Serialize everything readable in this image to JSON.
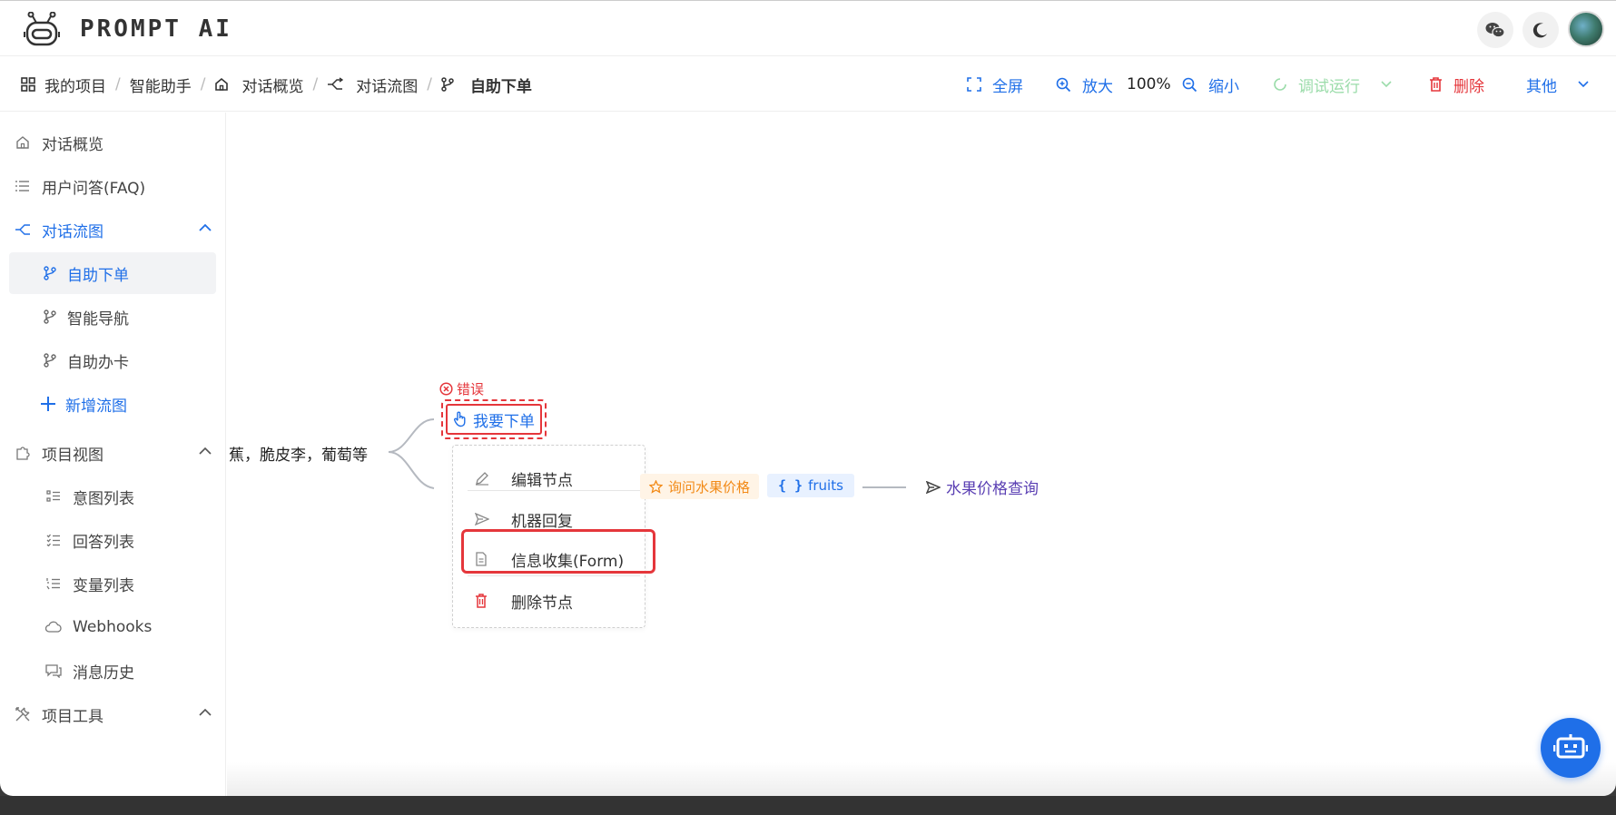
{
  "app": {
    "brand": "PROMPT  AI"
  },
  "breadcrumb": {
    "items": [
      "我的项目",
      "智能助手",
      "对话概览",
      "对话流图",
      "自助下单"
    ],
    "separator": "/"
  },
  "toolbar": {
    "fullscreen_label": "全屏",
    "zoom_in_label": "放大",
    "zoom_level": "100%",
    "zoom_out_label": "缩小",
    "debug_run_label": "调试运行",
    "delete_label": "删除",
    "more_label": "其他"
  },
  "sidebar": {
    "items": [
      {
        "label": "对话概览",
        "icon": "home-icon"
      },
      {
        "label": "用户问答(FAQ)",
        "icon": "list-icon"
      },
      {
        "label": "对话流图",
        "icon": "flow-icon",
        "expanded": true
      },
      {
        "label": "自助下单",
        "icon": "branch-icon",
        "active": true
      },
      {
        "label": "智能导航",
        "icon": "branch-icon"
      },
      {
        "label": "自助办卡",
        "icon": "branch-icon"
      },
      {
        "label": "新增流图",
        "icon": "plus-icon"
      },
      {
        "label": "项目视图",
        "icon": "puzzle-icon",
        "expanded": true
      },
      {
        "label": "意图列表",
        "icon": "intent-list-icon"
      },
      {
        "label": "回答列表",
        "icon": "check-list-icon"
      },
      {
        "label": "变量列表",
        "icon": "ordered-list-icon"
      },
      {
        "label": "Webhooks",
        "icon": "cloud-icon"
      },
      {
        "label": "消息历史",
        "icon": "chat-icon"
      },
      {
        "label": "项目工具",
        "icon": "tools-icon"
      }
    ]
  },
  "canvas": {
    "left_node_text": "蕉，脆皮李，葡萄等",
    "error_label": "错误",
    "order_node_label": "我要下单",
    "context_menu": {
      "edit": "编辑节点",
      "bot_reply": "机器回复",
      "form": "信息收集(Form)",
      "delete": "删除节点"
    },
    "intent_tag": "询问水果价格",
    "variable_tag": "fruits",
    "reply_link": "水果价格查询"
  },
  "colors": {
    "primary": "#1f6fe8",
    "danger": "#e5363b",
    "warning": "#f28a17",
    "success_muted": "#9bdcaa",
    "reply": "#5a3fb3"
  }
}
